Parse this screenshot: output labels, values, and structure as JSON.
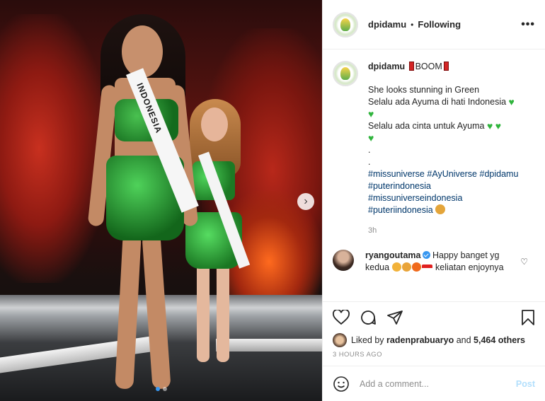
{
  "header": {
    "username": "dpidamu",
    "bullet": "•",
    "follow_status": "Following",
    "more": "•••"
  },
  "photo": {
    "sash_text": "INDONESIA",
    "carousel_dots": 2,
    "active_dot": 1
  },
  "caption": {
    "username": "dpidamu",
    "title": "BOOM",
    "line1": "She looks stunning in Green",
    "line2": "Selalu ada Ayuma di hati Indonesia",
    "line3": "Selalu ada cinta untuk Ayuma",
    "dot1": ".",
    "dot2": ".",
    "tag1": "#missuniverse",
    "tag2": "#AyUniverse",
    "tag3": "#dpidamu",
    "tag4": "#puterindonesia",
    "tag5": "#missuniverseindonesia",
    "tag6": "#puteriindonesia",
    "time": "3h"
  },
  "comment": {
    "username": "ryangoutama",
    "text_a": "Happy banget yg kedua",
    "text_b": "keliatan enjoynya"
  },
  "likes": {
    "prefix": "Liked by",
    "user": "radenprabuaryo",
    "and": "and",
    "count": "5,464 others"
  },
  "timestamp": "3 HOURS AGO",
  "add_comment": {
    "placeholder": "Add a comment...",
    "post_label": "Post"
  },
  "colors": {
    "accent_blue": "#3897f0",
    "tag_blue": "#00376b",
    "heart_green": "#2fb43c"
  }
}
